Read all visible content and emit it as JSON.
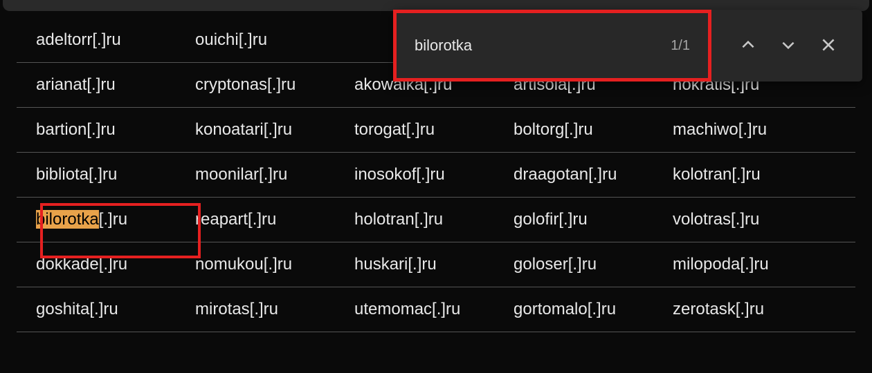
{
  "find": {
    "query": "bilorotka",
    "count": "1/1"
  },
  "highlightMatch": "bilorotka",
  "rows": [
    [
      "adeltorr[.]ru",
      "ouichi[.]ru",
      "",
      "",
      ""
    ],
    [
      "arianat[.]ru",
      "cryptonas[.]ru",
      "akowaika[.]ru",
      "artisola[.]ru",
      "nokratis[.]ru"
    ],
    [
      "bartion[.]ru",
      "konoatari[.]ru",
      "torogat[.]ru",
      "boltorg[.]ru",
      "machiwo[.]ru"
    ],
    [
      "bibliota[.]ru",
      "moonilar[.]ru",
      "inosokof[.]ru",
      "draagotan[.]ru",
      "kolotran[.]ru"
    ],
    [
      "bilorotka[.]ru",
      "reapart[.]ru",
      "holotran[.]ru",
      "golofir[.]ru",
      "volotras[.]ru"
    ],
    [
      "dokkade[.]ru",
      "nomukou[.]ru",
      "huskari[.]ru",
      "goloser[.]ru",
      "milopoda[.]ru"
    ],
    [
      "goshita[.]ru",
      "mirotas[.]ru",
      "utemomac[.]ru",
      "gortomalo[.]ru",
      "zerotask[.]ru"
    ]
  ]
}
